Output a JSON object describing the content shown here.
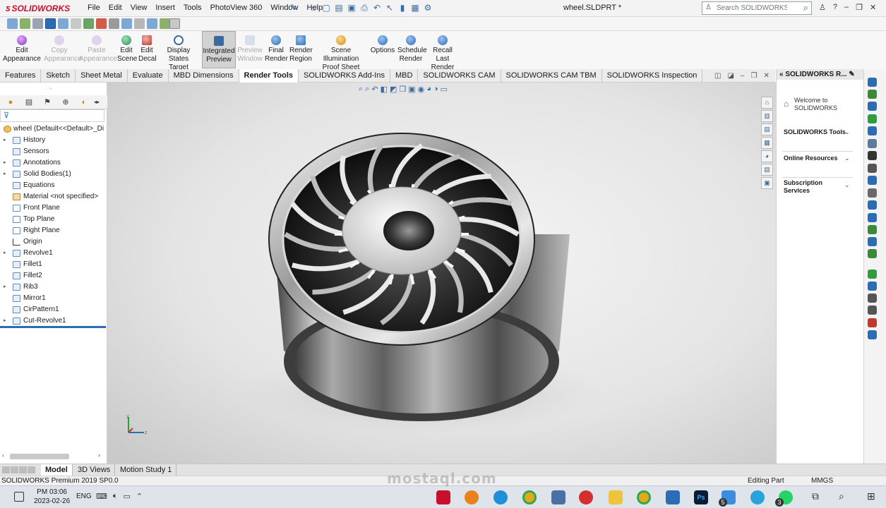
{
  "app": {
    "brand": "SOLIDWORKS",
    "document_title": "wheel.SLDPRT *",
    "menus": [
      "File",
      "Edit",
      "View",
      "Insert",
      "Tools",
      "PhotoView 360",
      "Window",
      "Help"
    ],
    "search_placeholder": "Search SOLIDWORKS Help"
  },
  "ribbon": {
    "buttons": [
      {
        "label": "Edit Appearance",
        "enabled": true,
        "color": "#7a3fb8"
      },
      {
        "label": "Copy Appearance",
        "enabled": false,
        "color": "#7a3fb8"
      },
      {
        "label": "Paste Appearance",
        "enabled": false,
        "color": "#7a3fb8"
      },
      {
        "label": "Edit Scene",
        "enabled": true,
        "color": "#2e8b57"
      },
      {
        "label": "Edit Decal",
        "enabled": true,
        "color": "#c0392b"
      },
      {
        "label": "Display States Target",
        "enabled": true,
        "color": "#3b6aa0"
      },
      {
        "label": "Integrated Preview",
        "enabled": true,
        "active": true,
        "color": "#3b6aa0"
      },
      {
        "label": "Preview Window",
        "enabled": false,
        "color": "#3b6aa0"
      },
      {
        "label": "Final Render",
        "enabled": true,
        "color": "#2a6db5"
      },
      {
        "label": "Render Region",
        "enabled": true,
        "color": "#2a6db5"
      },
      {
        "label": "Scene Illumination Proof Sheet",
        "enabled": true,
        "color": "#d58a1b"
      },
      {
        "label": "Options",
        "enabled": true,
        "color": "#2a6db5"
      },
      {
        "label": "Schedule Render",
        "enabled": true,
        "color": "#2a6db5"
      },
      {
        "label": "Recall Last Render",
        "enabled": true,
        "color": "#2a6db5"
      }
    ]
  },
  "command_tabs": [
    {
      "label": "Features"
    },
    {
      "label": "Sketch"
    },
    {
      "label": "Sheet Metal"
    },
    {
      "label": "Evaluate"
    },
    {
      "label": "MBD Dimensions"
    },
    {
      "label": "Render Tools",
      "active": true
    },
    {
      "label": "SOLIDWORKS Add-Ins"
    },
    {
      "label": "MBD"
    },
    {
      "label": "SOLIDWORKS CAM"
    },
    {
      "label": "SOLIDWORKS CAM TBM"
    },
    {
      "label": "SOLIDWORKS Inspection"
    }
  ],
  "feature_tree": {
    "root": "wheel  (Default<<Default>_Di",
    "items": [
      {
        "label": "History",
        "expandable": true
      },
      {
        "label": "Sensors",
        "expandable": false
      },
      {
        "label": "Annotations",
        "expandable": true
      },
      {
        "label": "Solid Bodies(1)",
        "expandable": true
      },
      {
        "label": "Equations",
        "expandable": false
      },
      {
        "label": "Material <not specified>",
        "expandable": false
      },
      {
        "label": "Front Plane",
        "expandable": false
      },
      {
        "label": "Top Plane",
        "expandable": false
      },
      {
        "label": "Right Plane",
        "expandable": false
      },
      {
        "label": "Origin",
        "expandable": false
      },
      {
        "label": "Revolve1",
        "expandable": true
      },
      {
        "label": "Fillet1",
        "expandable": false
      },
      {
        "label": "Fillet2",
        "expandable": false
      },
      {
        "label": "Rib3",
        "expandable": true
      },
      {
        "label": "Mirror1",
        "expandable": false
      },
      {
        "label": "CirPattern1",
        "expandable": false
      },
      {
        "label": "Cut-Revolve1",
        "expandable": true
      }
    ]
  },
  "task_pane": {
    "title": "SOLIDWORKS R...",
    "welcome": "Welcome to SOLIDWORKS",
    "sections": [
      "SOLIDWORKS Tools",
      "Online Resources",
      "Subscription Services"
    ]
  },
  "bottom_tabs": [
    {
      "label": "Model",
      "active": true
    },
    {
      "label": "3D Views"
    },
    {
      "label": "Motion Study 1"
    }
  ],
  "status": {
    "product": "SOLIDWORKS Premium 2019 SP0.0",
    "mode": "Editing Part",
    "units": "MMGS"
  },
  "taskbar": {
    "time": "PM 03:06",
    "date": "2023-02-26",
    "language": "ENG",
    "badges": [
      "5",
      "3"
    ]
  },
  "triad": {
    "y": "y",
    "z": "z"
  },
  "watermark": "mostaql.com"
}
